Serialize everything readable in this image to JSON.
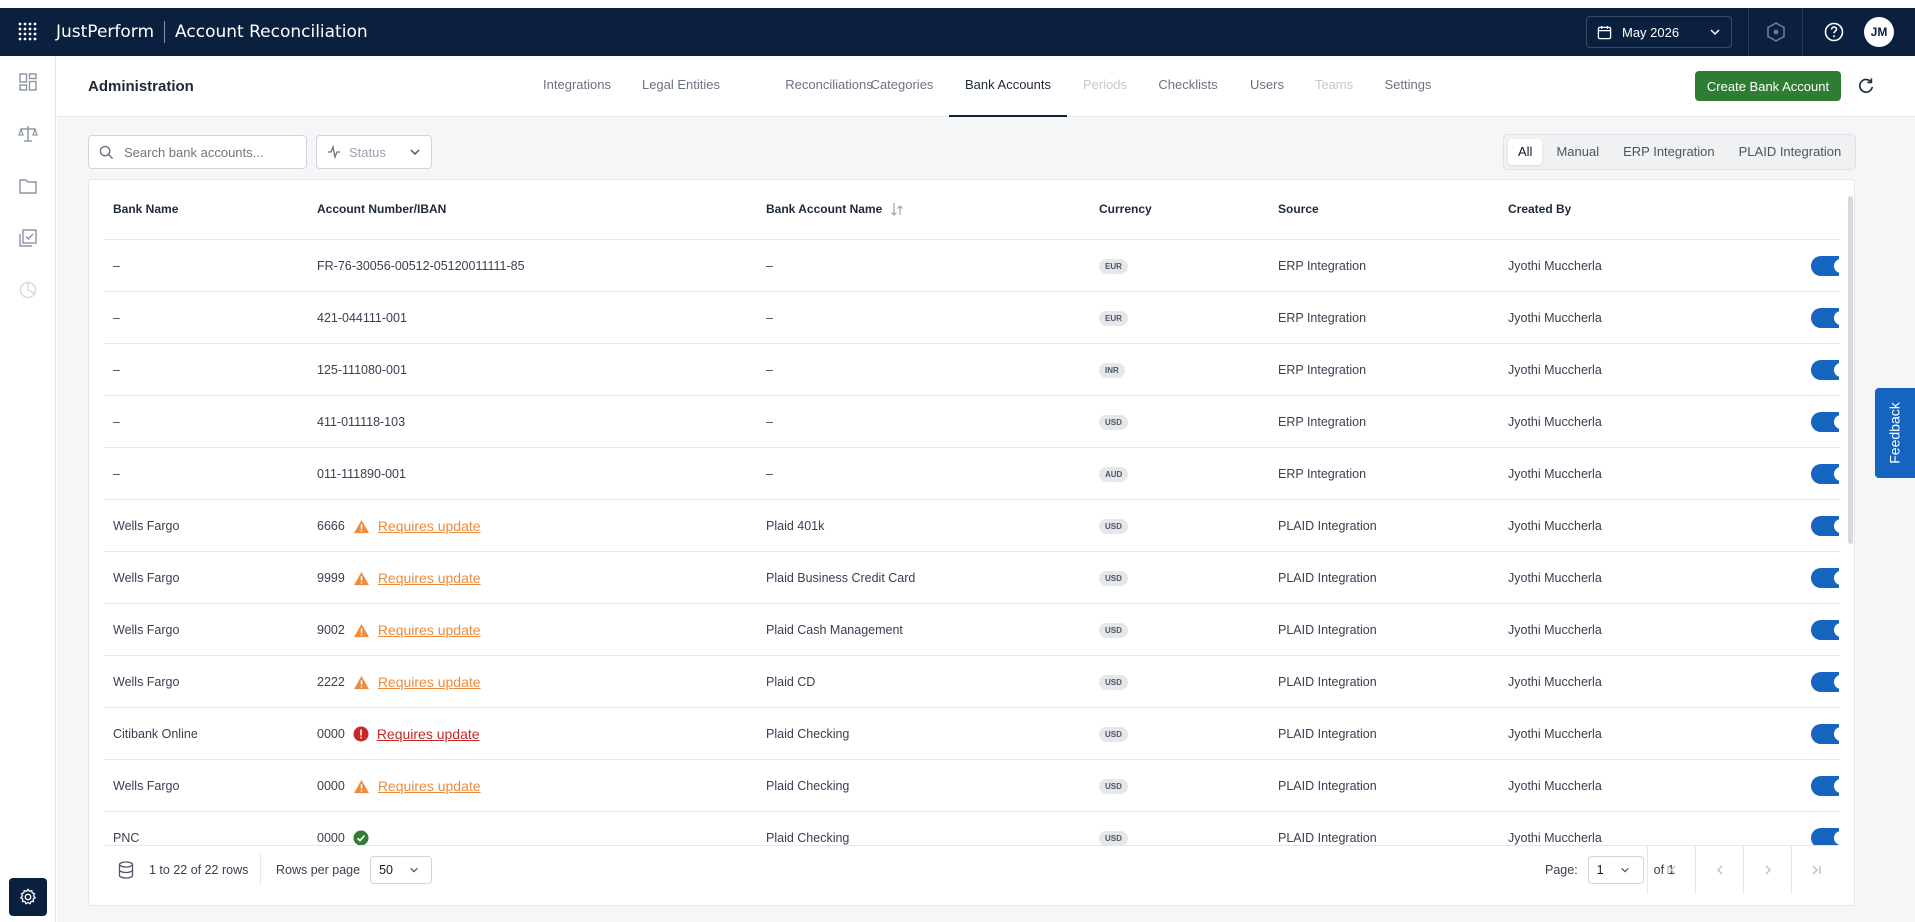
{
  "topbar": {
    "brand": "JustPerform",
    "app_title": "Account Reconciliation",
    "period": "May 2026",
    "avatar_initials": "JM"
  },
  "admin": {
    "title": "Administration",
    "tabs": [
      {
        "label": "Integrations",
        "state": "normal"
      },
      {
        "label": "Legal Entities",
        "state": "normal"
      },
      {
        "label": "Reconciliations",
        "state": "normal"
      },
      {
        "label": "Categories",
        "state": "normal"
      },
      {
        "label": "Bank Accounts",
        "state": "active"
      },
      {
        "label": "Periods",
        "state": "disabled"
      },
      {
        "label": "Checklists",
        "state": "normal"
      },
      {
        "label": "Users",
        "state": "normal"
      },
      {
        "label": "Teams",
        "state": "disabled"
      },
      {
        "label": "Settings",
        "state": "normal"
      }
    ],
    "create_button": "Create Bank Account"
  },
  "filters": {
    "search_placeholder": "Search bank accounts...",
    "status_label": "Status",
    "source_tabs": [
      {
        "label": "All",
        "active": true
      },
      {
        "label": "Manual",
        "active": false
      },
      {
        "label": "ERP Integration",
        "active": false
      },
      {
        "label": "PLAID Integration",
        "active": false
      }
    ]
  },
  "table": {
    "columns": [
      "Bank Name",
      "Account Number/IBAN",
      "Bank Account Name",
      "Currency",
      "Source",
      "Created By"
    ],
    "rows": [
      {
        "bank": "–",
        "account": "FR-76-30056-00512-05120011111-85",
        "status": "",
        "status_text": "",
        "name": "–",
        "currency": "EUR",
        "source": "ERP Integration",
        "created_by": "Jyothi Muccherla",
        "enabled": true
      },
      {
        "bank": "–",
        "account": "421-044111-001",
        "status": "",
        "status_text": "",
        "name": "–",
        "currency": "EUR",
        "source": "ERP Integration",
        "created_by": "Jyothi Muccherla",
        "enabled": true
      },
      {
        "bank": "–",
        "account": "125-111080-001",
        "status": "",
        "status_text": "",
        "name": "–",
        "currency": "INR",
        "source": "ERP Integration",
        "created_by": "Jyothi Muccherla",
        "enabled": true
      },
      {
        "bank": "–",
        "account": "411-011118-103",
        "status": "",
        "status_text": "",
        "name": "–",
        "currency": "USD",
        "source": "ERP Integration",
        "created_by": "Jyothi Muccherla",
        "enabled": true
      },
      {
        "bank": "–",
        "account": "011-111890-001",
        "status": "",
        "status_text": "",
        "name": "–",
        "currency": "AUD",
        "source": "ERP Integration",
        "created_by": "Jyothi Muccherla",
        "enabled": true
      },
      {
        "bank": "Wells Fargo",
        "account": "6666",
        "status": "warning",
        "status_text": "Requires update",
        "name": "Plaid 401k",
        "currency": "USD",
        "source": "PLAID Integration",
        "created_by": "Jyothi Muccherla",
        "enabled": true
      },
      {
        "bank": "Wells Fargo",
        "account": "9999",
        "status": "warning",
        "status_text": "Requires update",
        "name": "Plaid Business Credit Card",
        "currency": "USD",
        "source": "PLAID Integration",
        "created_by": "Jyothi Muccherla",
        "enabled": true
      },
      {
        "bank": "Wells Fargo",
        "account": "9002",
        "status": "warning",
        "status_text": "Requires update",
        "name": "Plaid Cash Management",
        "currency": "USD",
        "source": "PLAID Integration",
        "created_by": "Jyothi Muccherla",
        "enabled": true
      },
      {
        "bank": "Wells Fargo",
        "account": "2222",
        "status": "warning",
        "status_text": "Requires update",
        "name": "Plaid CD",
        "currency": "USD",
        "source": "PLAID Integration",
        "created_by": "Jyothi Muccherla",
        "enabled": true
      },
      {
        "bank": "Citibank Online",
        "account": "0000",
        "status": "error",
        "status_text": "Requires update",
        "name": "Plaid Checking",
        "currency": "USD",
        "source": "PLAID Integration",
        "created_by": "Jyothi Muccherla",
        "enabled": true
      },
      {
        "bank": "Wells Fargo",
        "account": "0000",
        "status": "warning",
        "status_text": "Requires update",
        "name": "Plaid Checking",
        "currency": "USD",
        "source": "PLAID Integration",
        "created_by": "Jyothi Muccherla",
        "enabled": true
      },
      {
        "bank": "PNC",
        "account": "0000",
        "status": "ok",
        "status_text": "",
        "name": "Plaid Checking",
        "currency": "USD",
        "source": "PLAID Integration",
        "created_by": "Jyothi Muccherla",
        "enabled": true
      }
    ]
  },
  "footer": {
    "rows_text": "1 to 22 of 22 rows",
    "rows_per_page_label": "Rows per page",
    "rows_per_page_value": "50",
    "page_label": "Page:",
    "page_value": "1",
    "page_of": "of 1"
  },
  "feedback_label": "Feedback",
  "colors": {
    "navy": "#0b1f3f",
    "create_green": "#2e7d32",
    "toggle_blue": "#1565c0",
    "warning_orange": "#ee8b3a",
    "error_red": "#c62828",
    "ok_green": "#2e7d32"
  }
}
